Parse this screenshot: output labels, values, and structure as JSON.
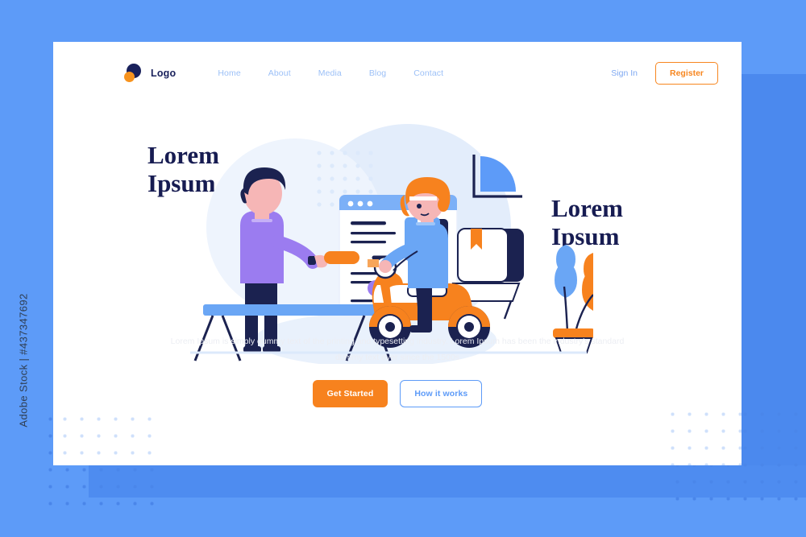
{
  "page": {
    "background_color": "#5d9bf8",
    "card_color": "#ffffff",
    "accent_orange": "#f7821e",
    "accent_blue": "#5d9bf8",
    "heading_navy": "#171c52"
  },
  "nav": {
    "brand": "Logo",
    "links": [
      {
        "label": "Home"
      },
      {
        "label": "About"
      },
      {
        "label": "Media"
      },
      {
        "label": "Blog"
      },
      {
        "label": "Contact"
      }
    ],
    "sign_in": "Sign In",
    "register": "Register"
  },
  "hero": {
    "headline_left": "Lorem\nIpsum",
    "headline_right": "Lorem\nIpsum",
    "subtext": "Lorem Ipsum is simply dummy text of the printing  and typesetting industry. Lorem Ipsum has been the industry's standard dummy text ever since the 1500s",
    "cta_primary": "Get Started",
    "cta_secondary": "How it works"
  },
  "watermark": {
    "text": "Adobe Stock | #437347692"
  }
}
